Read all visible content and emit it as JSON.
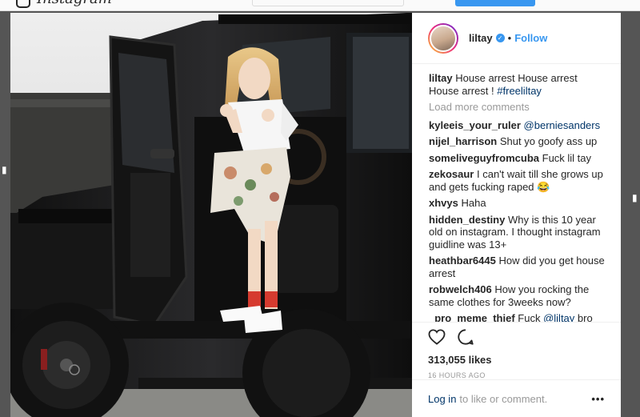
{
  "app": {
    "logo_text": "Instagram"
  },
  "post": {
    "username": "liltay",
    "verified": true,
    "separator": "•",
    "follow_label": "Follow",
    "caption": {
      "text": "House arrest House arrest House arrest !",
      "hashtag": "#freeliltay"
    },
    "load_more_label": "Load more comments",
    "comments": [
      {
        "user": "kyleeis_your_ruler",
        "text": "",
        "mention": "@berniesanders"
      },
      {
        "user": "nijel_harrison",
        "text": "Shut yo goofy ass up"
      },
      {
        "user": "someliveguyfromcuba",
        "text": "Fuck lil tay"
      },
      {
        "user": "zekosaur",
        "text": "I can't wait till she grows up and gets fucking raped 😂"
      },
      {
        "user": "xhvys",
        "text": "Haha"
      },
      {
        "user": "hidden_destiny",
        "text": "Why is this 10 year old on instagram. I thought instagram guidline was 13+"
      },
      {
        "user": "heathbar6445",
        "text": "How did you get house arrest"
      },
      {
        "user": "robwelch406",
        "text": "How you rocking the same clothes for 3weeks now?"
      },
      {
        "user": "_pro_meme_thief",
        "text": "Fuck",
        "mention": "@liltay",
        "text_after": "bro she is a"
      }
    ],
    "likes": "313,055 likes",
    "timestamp": "16 HOURS AGO",
    "login_label": "Log in",
    "login_suffix": "to like or comment.",
    "more_options": "•••"
  },
  "colors": {
    "link_blue": "#3897f0",
    "dark_link": "#003569",
    "muted": "#999999"
  }
}
